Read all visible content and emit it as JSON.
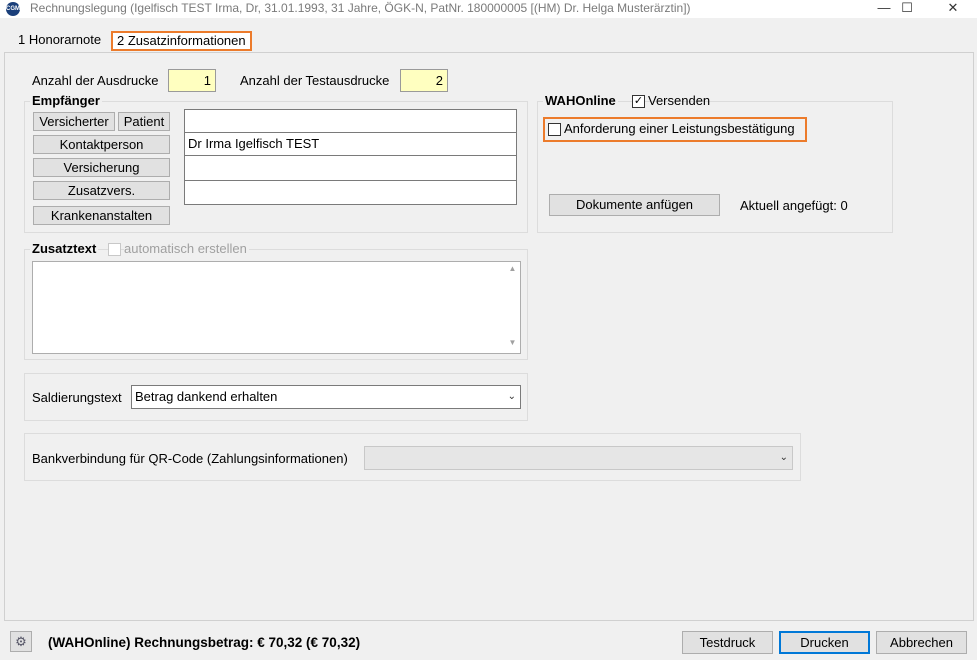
{
  "window": {
    "title": "Rechnungslegung (Igelfisch TEST Irma, Dr, 31.01.1993, 31 Jahre, ÖGK-N, PatNr. 180000005 [(HM) Dr. Helga Musterärztin])",
    "icon_text": "CGM",
    "minimize": "—",
    "maximize": "☐",
    "close": "✕"
  },
  "tabs": [
    {
      "label": "1 Honorarnote"
    },
    {
      "label": "2 Zusatzinformationen"
    }
  ],
  "prints": {
    "ausdrucke_label": "Anzahl der Ausdrucke",
    "ausdrucke_value": "1",
    "testausdrucke_label": "Anzahl der Testausdrucke",
    "testausdrucke_value": "2"
  },
  "empfaenger": {
    "legend": "Empfänger",
    "buttons": {
      "versicherter": "Versicherter",
      "patient": "Patient",
      "kontaktperson": "Kontaktperson",
      "versicherung": "Versicherung",
      "zusatzvers": "Zusatzvers.",
      "krankenanstalten": "Krankenanstalten"
    },
    "fields": [
      "",
      "Dr Irma Igelfisch TEST",
      "",
      ""
    ]
  },
  "wahonline": {
    "legend": "WAHOnline",
    "versenden_label": "Versenden",
    "versenden_checked": "✓",
    "anforderung_label": "Anforderung einer Leistungsbestätigung",
    "dokumente_button": "Dokumente anfügen",
    "aktuell_label": "Aktuell angefügt: 0"
  },
  "zusatztext": {
    "legend": "Zusatztext",
    "auto_label": "automatisch erstellen",
    "value": "",
    "scroll_up": "▲",
    "scroll_down": "▼"
  },
  "saldierung": {
    "label": "Saldierungstext",
    "value": "Betrag dankend erhalten",
    "arrow": "⌄"
  },
  "bank": {
    "label": "Bankverbindung für QR-Code (Zahlungsinformationen)",
    "value": "",
    "arrow": "⌄"
  },
  "status": {
    "text": "(WAHOnline) Rechnungsbetrag: € 70,32 (€ 70,32)",
    "testdruck": "Testdruck",
    "drucken": "Drucken",
    "abbrechen": "Abbrechen",
    "settings_icon": "⚙"
  },
  "colors": {
    "highlight": "#ec7b2b",
    "required_field": "#ffffc0",
    "default_button": "#0078d7"
  }
}
